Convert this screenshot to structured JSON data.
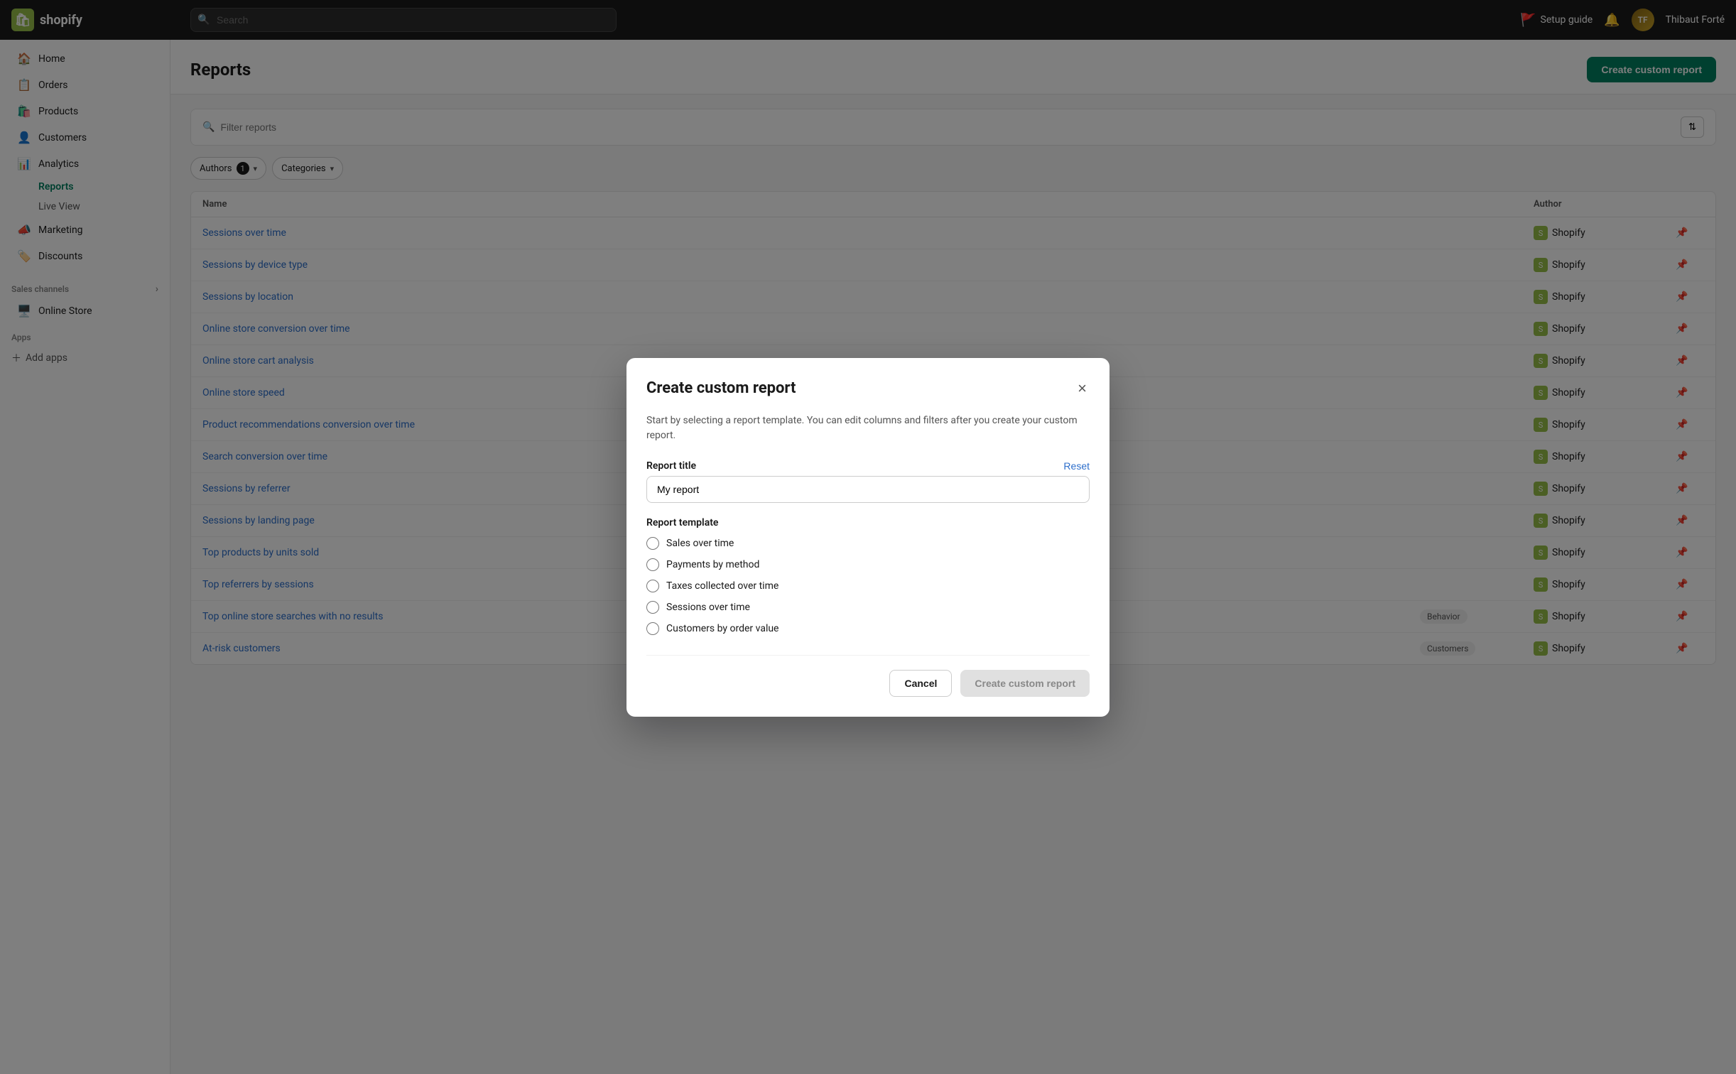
{
  "topbar": {
    "logo_text": "shopify",
    "search_placeholder": "Search",
    "setup_guide_label": "Setup guide",
    "user_name": "Thibaut Forté"
  },
  "sidebar": {
    "items": [
      {
        "id": "home",
        "label": "Home",
        "icon": "🏠"
      },
      {
        "id": "orders",
        "label": "Orders",
        "icon": "📋"
      },
      {
        "id": "products",
        "label": "Products",
        "icon": "🛍️"
      },
      {
        "id": "customers",
        "label": "Customers",
        "icon": "👤"
      },
      {
        "id": "analytics",
        "label": "Analytics",
        "icon": "📊"
      },
      {
        "id": "reports",
        "label": "Reports",
        "icon": "",
        "sub": true
      },
      {
        "id": "liveview",
        "label": "Live View",
        "icon": "",
        "sub": true
      },
      {
        "id": "marketing",
        "label": "Marketing",
        "icon": "📣"
      },
      {
        "id": "discounts",
        "label": "Discounts",
        "icon": "🏷️"
      }
    ],
    "sales_channels_label": "Sales channels",
    "online_store_label": "Online Store",
    "apps_label": "Apps",
    "add_apps_label": "Add apps"
  },
  "page": {
    "title": "Reports",
    "create_button_label": "Create custom report"
  },
  "filters": {
    "search_placeholder": "Filter reports",
    "authors_chip_label": "Authors",
    "authors_count": "1",
    "categories_chip_label": "Categories"
  },
  "table": {
    "columns": [
      "Name",
      "",
      "Author"
    ],
    "rows": [
      {
        "name": "Ses...",
        "category": "",
        "author": "Shopify"
      },
      {
        "name": "Ses...",
        "category": "",
        "author": "Shopify"
      },
      {
        "name": "Ses...",
        "category": "",
        "author": "Shopify"
      },
      {
        "name": "Onl...",
        "category": "",
        "author": "Shopify"
      },
      {
        "name": "Onl...",
        "category": "",
        "author": "Shopify"
      },
      {
        "name": "Onl...",
        "category": "",
        "author": "Shopify"
      },
      {
        "name": "Pro...",
        "category": "",
        "author": "Shopify"
      },
      {
        "name": "Sea...",
        "category": "",
        "author": "Shopify"
      },
      {
        "name": "Ses...",
        "category": "",
        "author": "Shopify"
      },
      {
        "name": "Ses...",
        "category": "",
        "author": "Shopify"
      },
      {
        "name": "Top...",
        "category": "",
        "author": "Shopify"
      },
      {
        "name": "Top...",
        "category": "",
        "author": "Shopify"
      },
      {
        "name": "Top online store searches with no results",
        "category": "Behavior",
        "author": "Shopify"
      },
      {
        "name": "At-risk customers",
        "category": "Customers",
        "author": "Shopify"
      }
    ]
  },
  "modal": {
    "title": "Create custom report",
    "close_label": "×",
    "description": "Start by selecting a report template. You can edit columns and filters after you create your custom report.",
    "report_title_label": "Report title",
    "reset_label": "Reset",
    "report_title_value": "My report",
    "report_template_label": "Report template",
    "templates": [
      {
        "id": "sales_over_time",
        "label": "Sales over time"
      },
      {
        "id": "payments_by_method",
        "label": "Payments by method"
      },
      {
        "id": "taxes_collected",
        "label": "Taxes collected over time"
      },
      {
        "id": "sessions_over_time",
        "label": "Sessions over time"
      },
      {
        "id": "customers_by_order_value",
        "label": "Customers by order value"
      }
    ],
    "cancel_label": "Cancel",
    "create_label": "Create custom report"
  }
}
